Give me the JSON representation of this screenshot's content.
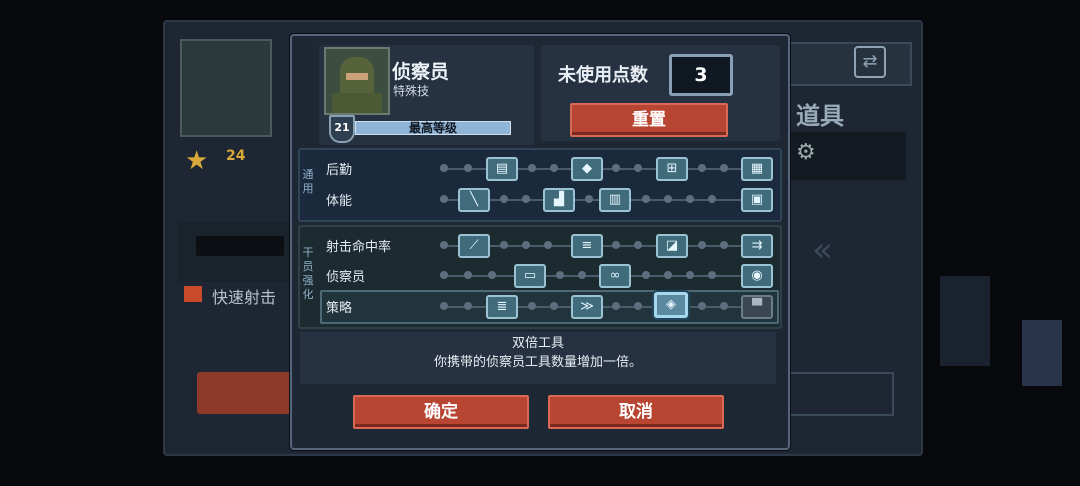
{
  "background": {
    "star_count": "24",
    "quick_fire_label": "快速射击",
    "items_label": "道具"
  },
  "character": {
    "name": "侦察员",
    "subtitle": "特殊技",
    "level": "21",
    "level_label": "最高等级"
  },
  "points": {
    "label": "未使用点数",
    "value": "3",
    "reset_label": "重置"
  },
  "skill_groups": [
    {
      "tag": "通用",
      "rows": [
        {
          "label": "后勤",
          "nodes": [
            "magazine-icon",
            "armor-plus-icon",
            "medkit-icon",
            "ammo-crate-icon"
          ]
        },
        {
          "label": "体能",
          "nodes": [
            "knife-icon",
            "boot-icon",
            "vest-icon",
            "backpack-icon"
          ]
        }
      ]
    },
    {
      "tag": "干员强化",
      "rows": [
        {
          "label": "射击命中率",
          "nodes": [
            "rifle-up-icon",
            "rifle-burst-icon",
            "scope-icon",
            "bullets-icon"
          ]
        },
        {
          "label": "侦察员",
          "nodes": [
            "drone-icon",
            "binoculars-icon",
            "radar-icon"
          ]
        },
        {
          "label": "策略",
          "nodes": [
            "bullets-plus-icon",
            "flank-icon",
            "double-tools-icon",
            "locked-icon"
          ]
        }
      ]
    }
  ],
  "selected_skill": {
    "title": "双倍工具",
    "description": "你携带的侦察员工具数量增加一倍。"
  },
  "buttons": {
    "confirm": "确定",
    "cancel": "取消"
  },
  "colors": {
    "accent_red": "#b84532",
    "panel": "#263241",
    "node": "#3f6b7a"
  }
}
